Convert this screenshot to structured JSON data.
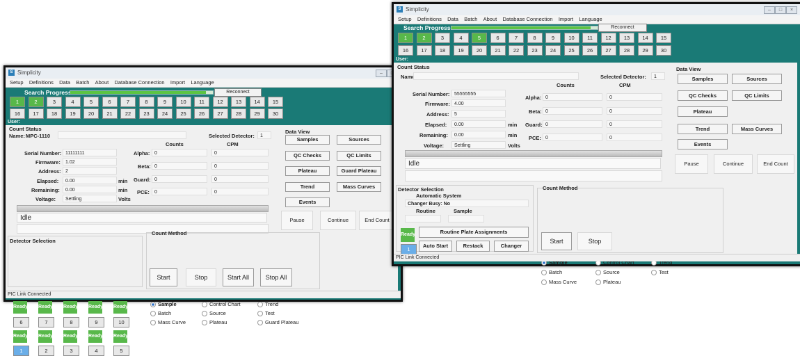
{
  "app_title": "Simplicity",
  "menu": [
    "Setup",
    "Definitions",
    "Data",
    "Batch",
    "About",
    "Database Connection",
    "Import",
    "Language"
  ],
  "search_progress_label": "Search Progress",
  "search_progress_fraction": 0.95,
  "reconnect_label": "Reconnect",
  "user_label": "User:",
  "count_status_title": "Count Status",
  "name_label": "Name:",
  "selected_detector_label": "Selected Detector:",
  "counts_header": "Counts",
  "cpm_header": "CPM",
  "serial_label": "Serial Number:",
  "firmware_label": "Firmware:",
  "address_label": "Address:",
  "elapsed_label": "Elapsed:",
  "remaining_label": "Remaining:",
  "voltage_label": "Voltage:",
  "min_unit": "min",
  "volts_unit": "Volts",
  "alpha_label": "Alpha:",
  "beta_label": "Beta:",
  "guard_label": "Guard:",
  "pce_label": "PCE:",
  "data_view_title": "Data View",
  "pause_label": "Pause",
  "continue_label": "Continue",
  "end_count_label": "End Count",
  "detector_selection_title": "Detector Selection",
  "count_method_title": "Count Method",
  "start_label": "Start",
  "stop_label": "Stop",
  "status_bar": "PIC Link Connected",
  "left": {
    "name_value": "MPC-1110",
    "selected_detector": "1",
    "serial": "11111111",
    "firmware": "1.02",
    "address": "2",
    "elapsed": "0.00",
    "remaining": "0.00",
    "voltage": "Settling",
    "alpha": "0",
    "alpha_cpm": "0",
    "beta": "0",
    "beta_cpm": "0",
    "guard": "0",
    "guard_cpm": "0",
    "pce": "0",
    "pce_cpm": "0",
    "idle": "Idle",
    "data_view_buttons": [
      "Samples",
      "Sources",
      "QC Checks",
      "QC Limits",
      "Plateau",
      "Guard Plateau",
      "Trend",
      "Mass Curves",
      "Events"
    ],
    "ready_label": "Ready",
    "detectors_row1": [
      "6",
      "7",
      "8",
      "9",
      "10"
    ],
    "detectors_row2": [
      "1",
      "2",
      "3",
      "4",
      "5"
    ],
    "count_methods": [
      "Sample",
      "Control Chart",
      "Trend",
      "Batch",
      "Source",
      "Test",
      "Mass Curve",
      "Plateau",
      "Guard Plateau"
    ],
    "start_all_label": "Start All",
    "stop_all_label": "Stop All"
  },
  "right": {
    "name_value": "",
    "selected_detector": "1",
    "serial": "55555555",
    "firmware": "4.00",
    "address": "5",
    "elapsed": "0.00",
    "remaining": "0.00",
    "voltage": "Settling",
    "alpha": "0",
    "alpha_cpm": "0",
    "beta": "0",
    "beta_cpm": "0",
    "guard": "0",
    "guard_cpm": "0",
    "pce": "0",
    "pce_cpm": "0",
    "idle": "Idle",
    "data_view_buttons": [
      "Samples",
      "Sources",
      "QC Checks",
      "QC Limits",
      "Plateau",
      "Trend",
      "Mass Curves",
      "Events"
    ],
    "automatic_system_label": "Automatic System",
    "changer_busy_label": "Changer Busy: No",
    "routine_label": "Routine",
    "sample_label": "Sample",
    "ready_label": "Ready",
    "routine_plate_label": "Routine Plate Assignments",
    "detector_one": "1",
    "auto_start_label": "Auto Start",
    "restack_label": "Restack",
    "changer_label": "Changer",
    "count_methods": [
      "Sample",
      "Control Chart",
      "Trend",
      "Batch",
      "Source",
      "Test",
      "Mass Curve",
      "Plateau"
    ]
  },
  "sample_numbers": [
    "1",
    "2",
    "3",
    "4",
    "5",
    "6",
    "7",
    "8",
    "9",
    "10",
    "11",
    "12",
    "13",
    "14",
    "15",
    "16",
    "17",
    "18",
    "19",
    "20",
    "21",
    "22",
    "23",
    "24",
    "25",
    "26",
    "27",
    "28",
    "29",
    "30"
  ],
  "colors": {
    "teal": "#1a7a76",
    "ready_green": "#58b84a",
    "selected_blue": "#6aaee8"
  }
}
